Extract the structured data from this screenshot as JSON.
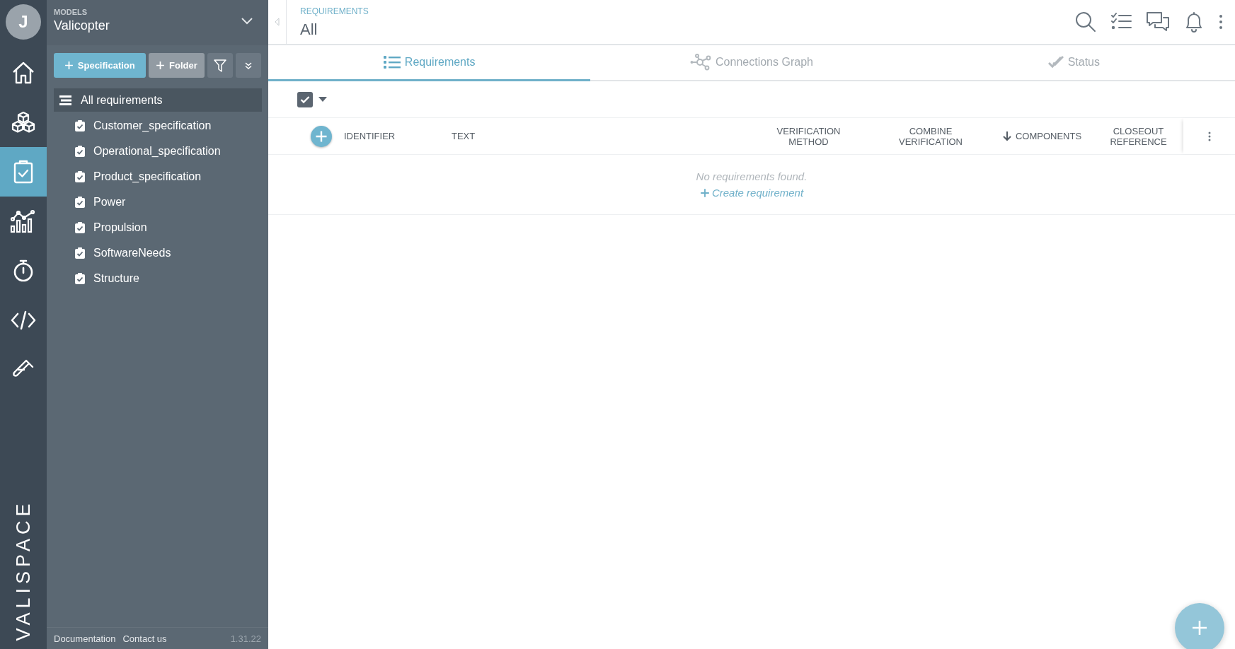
{
  "user": {
    "initial": "J"
  },
  "rail": [
    {
      "kind": "home",
      "selected": false
    },
    {
      "kind": "cubes",
      "selected": false
    },
    {
      "kind": "clipboard",
      "selected": true
    },
    {
      "kind": "chart",
      "selected": false
    },
    {
      "kind": "stopwatch",
      "selected": false
    },
    {
      "kind": "code",
      "selected": false
    },
    {
      "kind": "flask",
      "selected": false
    }
  ],
  "logo": "VALISPACE",
  "sidebar": {
    "section_label": "MODELS",
    "model": "Valicopter",
    "buttons": [
      {
        "kind": "primary",
        "label": "Specification"
      },
      {
        "kind": "secondary",
        "label": "Folder"
      },
      {
        "kind": "filter"
      },
      {
        "kind": "expand"
      }
    ],
    "tree": [
      {
        "label": "All requirements",
        "kind": "all",
        "selected": true,
        "children": [
          {
            "label": "Customer_specification",
            "kind": "spec",
            "selected": false
          },
          {
            "label": "Operational_specification",
            "kind": "spec",
            "selected": false
          },
          {
            "label": "Product_specification",
            "kind": "spec",
            "selected": false
          },
          {
            "label": "Power",
            "kind": "spec",
            "selected": false
          },
          {
            "label": "Propulsion",
            "kind": "spec",
            "selected": false
          },
          {
            "label": "SoftwareNeeds",
            "kind": "spec",
            "selected": false
          },
          {
            "label": "Structure",
            "kind": "spec",
            "selected": false
          }
        ]
      }
    ],
    "footer": {
      "links": [
        "Documentation",
        "Contact us"
      ],
      "version": "1.31.22"
    }
  },
  "header": {
    "breadcrumb": "REQUIREMENTS",
    "title": "All",
    "actions": [
      {
        "kind": "search"
      },
      {
        "kind": "checklist"
      },
      {
        "kind": "chat"
      },
      {
        "kind": "bell"
      },
      {
        "kind": "more"
      }
    ]
  },
  "tabs": [
    {
      "label": "Requirements",
      "kind": "list",
      "selected": true
    },
    {
      "label": "Connections Graph",
      "kind": "graph",
      "selected": false
    },
    {
      "label": "Status",
      "kind": "status",
      "selected": false
    }
  ],
  "toolbar": {
    "select_all_checked": true
  },
  "table": {
    "columns": [
      {
        "label": "IDENTIFIER",
        "sorted": false
      },
      {
        "label": "TEXT",
        "sorted": false
      },
      {
        "label": "VERIFICATION METHOD",
        "sorted": false
      },
      {
        "label": "COMBINE VERIFICATION",
        "sorted": false
      },
      {
        "label": "COMPONENTS",
        "sorted": true
      },
      {
        "label": "CLOSEOUT REFERENCE",
        "sorted": false
      }
    ],
    "empty_message": "No requirements found.",
    "create_link": "Create requirement"
  }
}
